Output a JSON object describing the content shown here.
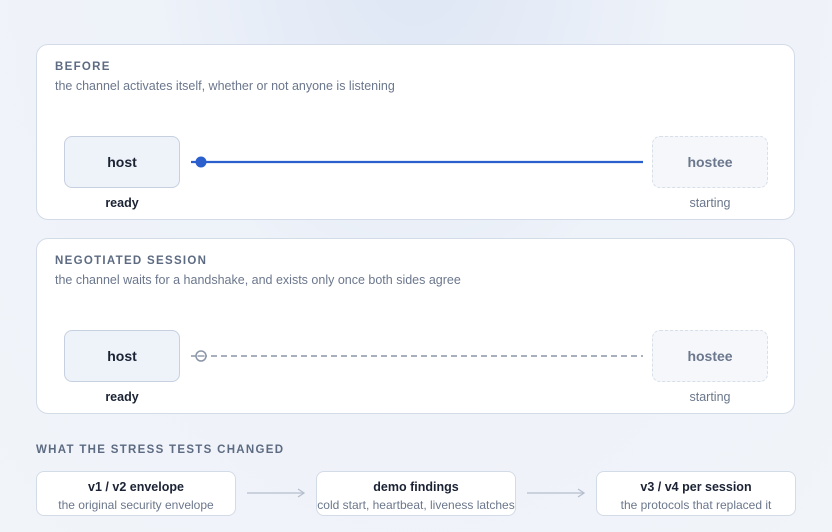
{
  "before": {
    "title": "BEFORE",
    "subtitle": "the channel activates itself, whether or not anyone is listening",
    "host_label": "host",
    "hostee_label": "hostee",
    "host_state": "ready",
    "hostee_state": "starting",
    "link_style": "solid",
    "link_color": "#2b5fce"
  },
  "negotiated": {
    "title": "NEGOTIATED SESSION",
    "subtitle": "the channel waits for a handshake, and exists only once both sides agree",
    "host_label": "host",
    "hostee_label": "hostee",
    "host_state": "ready",
    "hostee_state": "starting",
    "link_style": "dashed",
    "link_color": "#8b96a8"
  },
  "changes": {
    "title": "WHAT THE STRESS TESTS CHANGED",
    "steps": [
      {
        "title": "v1 / v2 envelope",
        "subtitle": "the original security envelope"
      },
      {
        "title": "demo findings",
        "subtitle": "cold start, heartbeat, liveness latches"
      },
      {
        "title": "v3 / v4 per session",
        "subtitle": "the protocols that replaced it"
      }
    ]
  }
}
